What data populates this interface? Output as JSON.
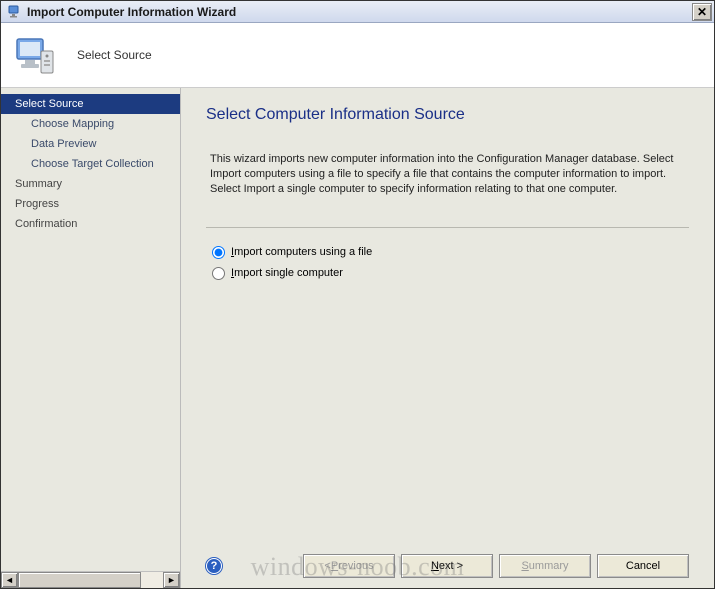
{
  "titlebar": {
    "title": "Import Computer Information Wizard",
    "close_glyph": "✕"
  },
  "banner": {
    "title": "Select Source"
  },
  "sidebar": {
    "items": [
      {
        "label": "Select Source",
        "type": "step",
        "selected": true
      },
      {
        "label": "Choose Mapping",
        "type": "substep"
      },
      {
        "label": "Data Preview",
        "type": "substep"
      },
      {
        "label": "Choose Target Collection",
        "type": "substep"
      },
      {
        "label": "Summary",
        "type": "step"
      },
      {
        "label": "Progress",
        "type": "step"
      },
      {
        "label": "Confirmation",
        "type": "step"
      }
    ],
    "scroll_left": "◄",
    "scroll_right": "►"
  },
  "main": {
    "heading": "Select Computer Information Source",
    "description": "This wizard imports new computer information into the Configuration Manager database. Select Import computers using a file to specify a file that contains the computer information to import. Select Import a single computer to specify information relating to that one computer.",
    "radios": [
      {
        "prefix": "I",
        "rest": "mport computers using a file",
        "checked": true
      },
      {
        "prefix": "I",
        "rest": "mport single computer",
        "checked": false
      }
    ]
  },
  "footer": {
    "help_glyph": "?",
    "previous_prefix": "< ",
    "previous_u": "P",
    "previous_rest": "revious",
    "next_u": "N",
    "next_rest": "ext >",
    "summary_u": "S",
    "summary_rest": "ummary",
    "cancel": "Cancel"
  },
  "watermark": "windows-noob.com"
}
